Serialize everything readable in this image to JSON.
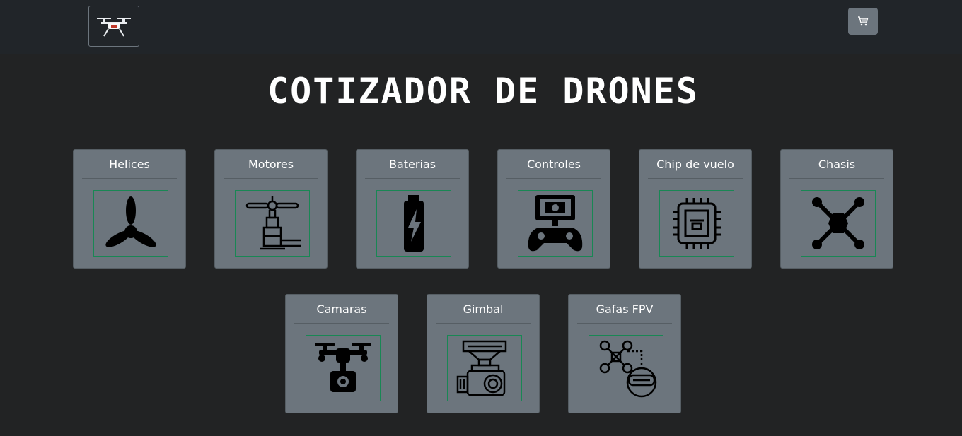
{
  "header": {
    "brand_icon": "drone-icon",
    "cart_icon": "cart-icon"
  },
  "main": {
    "title": "COTIZADOR DE DRONES"
  },
  "categories": [
    {
      "label": "Helices",
      "icon": "propeller-icon"
    },
    {
      "label": "Motores",
      "icon": "motor-icon"
    },
    {
      "label": "Baterias",
      "icon": "battery-icon"
    },
    {
      "label": "Controles",
      "icon": "controller-icon"
    },
    {
      "label": "Chip de vuelo",
      "icon": "chip-icon"
    },
    {
      "label": "Chasis",
      "icon": "frame-icon"
    },
    {
      "label": "Camaras",
      "icon": "camera-drone-icon"
    },
    {
      "label": "Gimbal",
      "icon": "gimbal-icon"
    },
    {
      "label": "Gafas FPV",
      "icon": "fpv-goggles-icon"
    }
  ]
}
